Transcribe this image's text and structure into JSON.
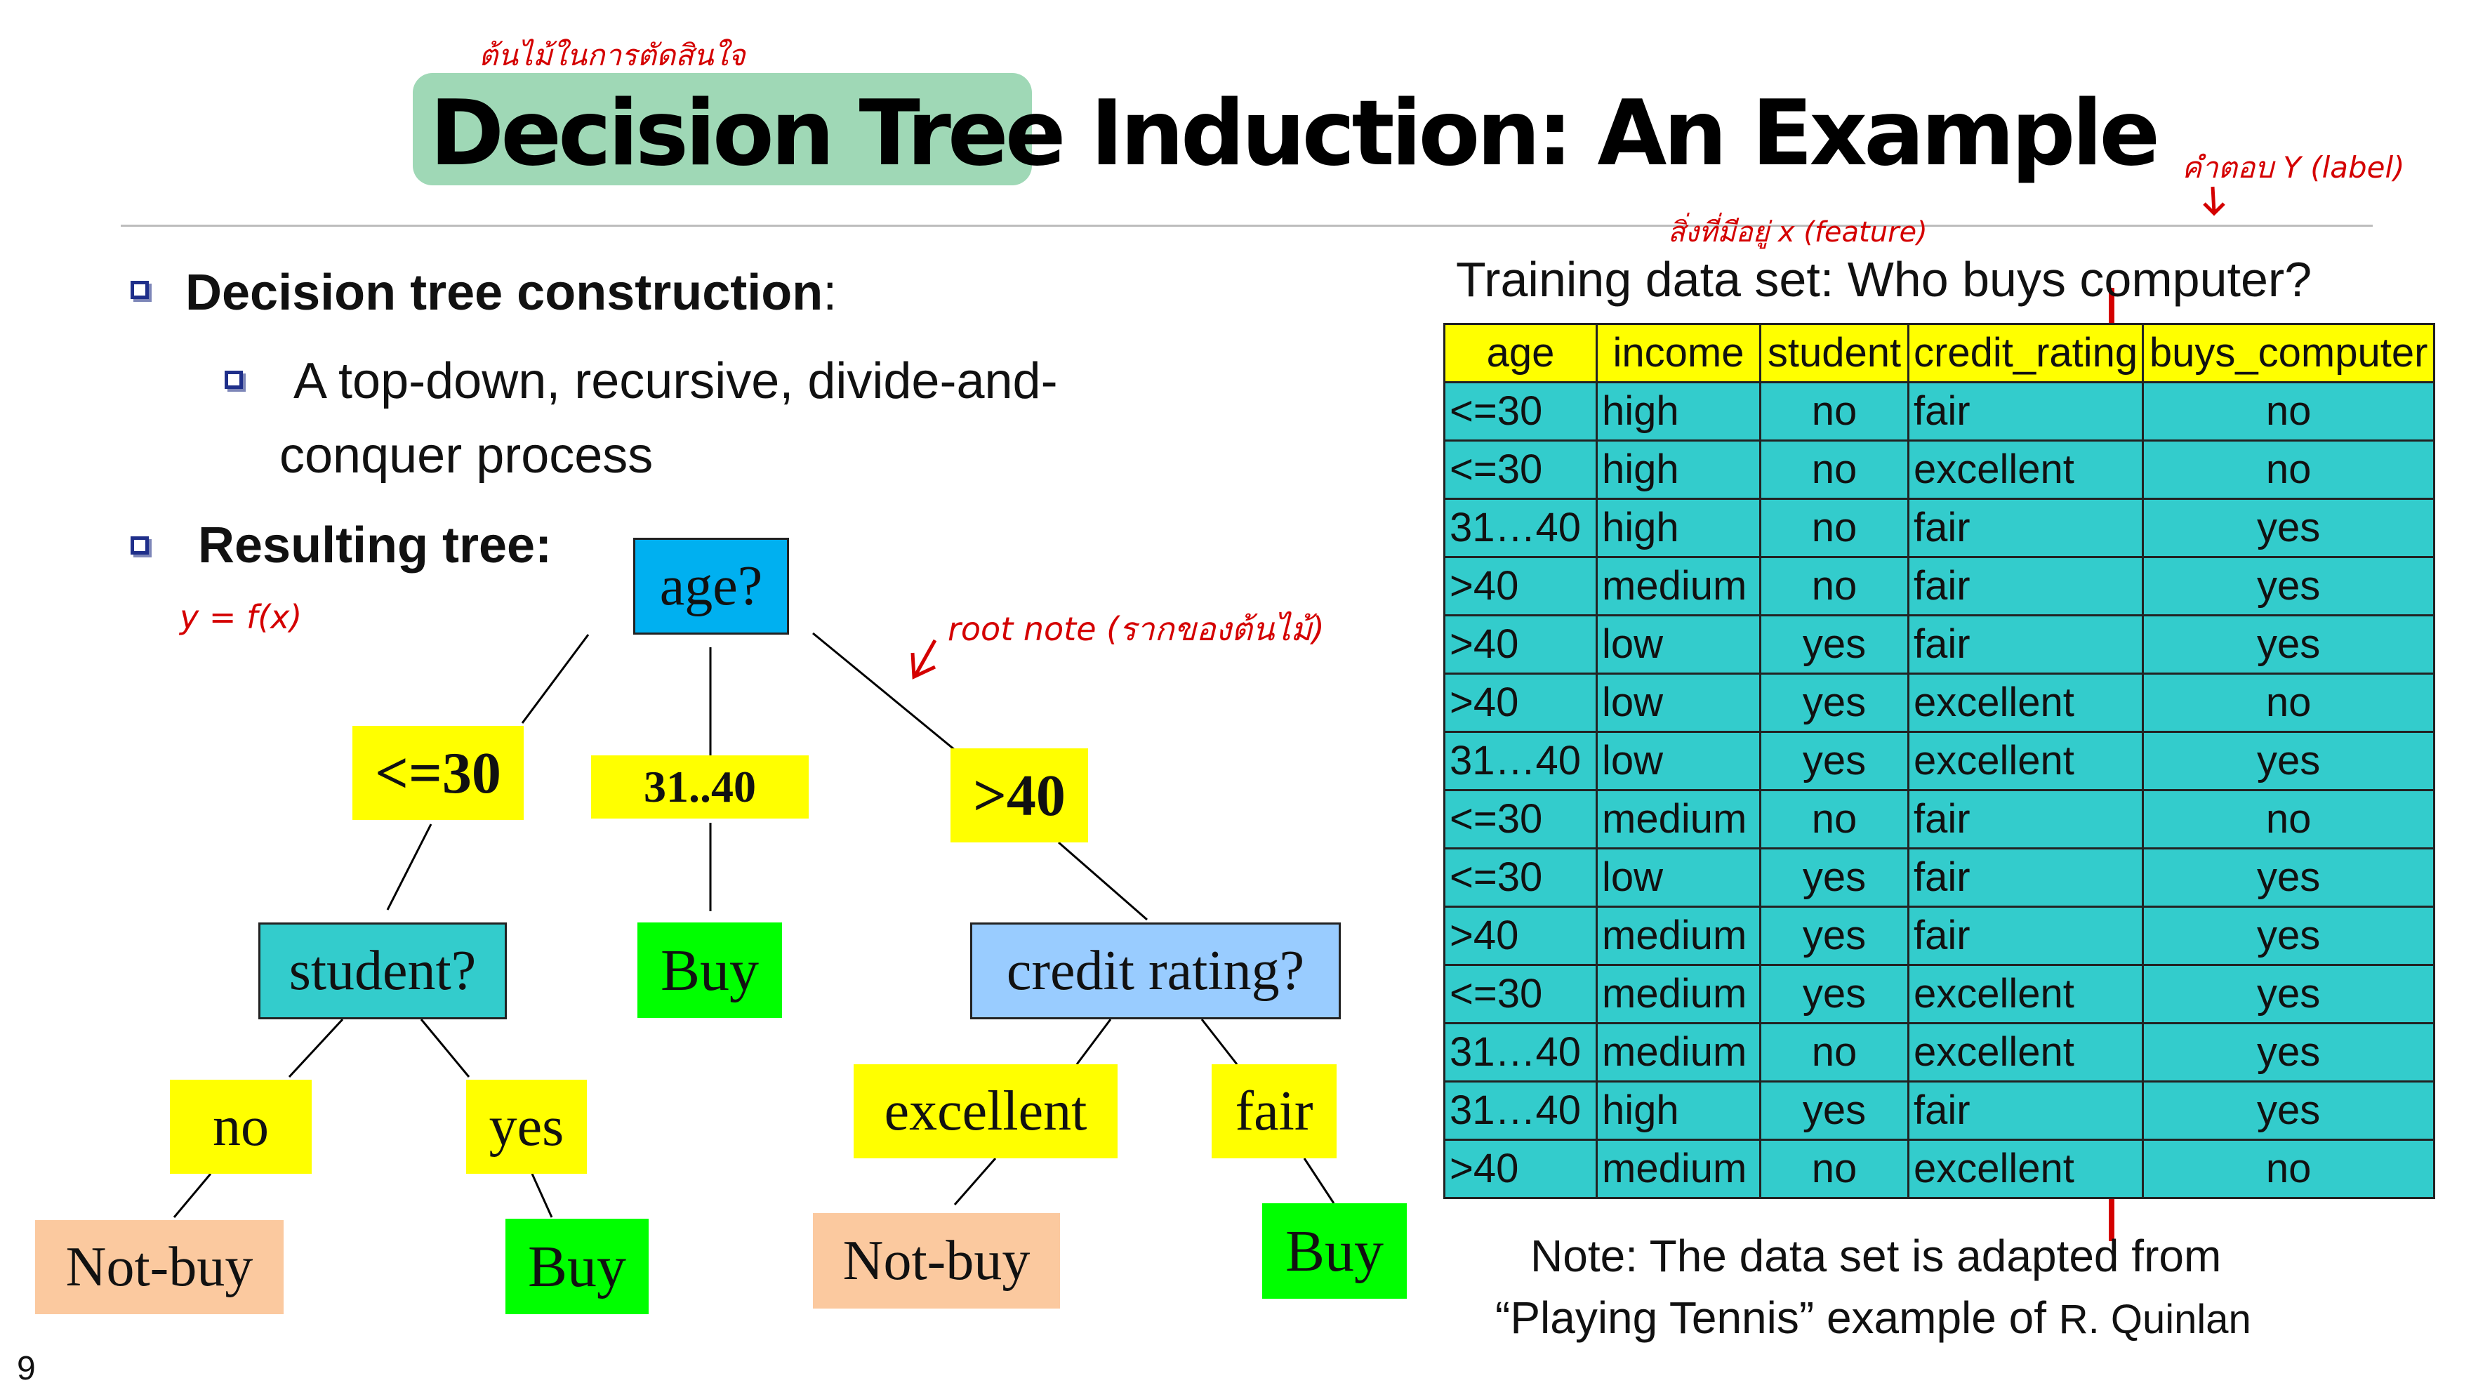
{
  "slide": {
    "title_highlighted": "Decision Tree",
    "title_rest": "Induction: An Example",
    "page_number": "9"
  },
  "annotations": {
    "thai_title": "ต้นไม้ในการตัดสินใจ",
    "y_fx": "y = f(x)",
    "root_note": "root note (รากของต้นไม้)",
    "feature_note": "สิ่งที่มีอยู่ x (feature)",
    "label_note": "คำตอบ Y (label)",
    "colors": {
      "ink": "#d40000"
    }
  },
  "bullets": {
    "b1_bold": "Decision tree construction",
    "b1_colon": ":",
    "b2_line1": "A top-down, recursive, divide-and-",
    "b2_line2": "conquer process",
    "b3": "Resulting tree:"
  },
  "tree": {
    "root": "age?",
    "branch_le30": "<=30",
    "branch_3140": "31..40",
    "branch_gt40": ">40",
    "student": "student?",
    "buy_mid": "Buy",
    "credit": "credit rating?",
    "no": "no",
    "yes": "yes",
    "excellent": "excellent",
    "fair": "fair",
    "notbuy_left": "Not-buy",
    "buy_left": "Buy",
    "notbuy_right": "Not-buy",
    "buy_right": "Buy",
    "colors": {
      "root": "#00b0f0",
      "branch": "#ffff00",
      "student": "#33cccc",
      "buy": "#00ff00",
      "credit": "#99ccff",
      "notbuy": "#fbc99f"
    }
  },
  "training": {
    "caption": "Training data set: Who buys computer?",
    "headers": [
      "age",
      "income",
      "student",
      "credit_rating",
      "buys_computer"
    ],
    "rows": [
      [
        "<=30",
        "high",
        "no",
        "fair",
        "no"
      ],
      [
        "<=30",
        "high",
        "no",
        "excellent",
        "no"
      ],
      [
        "31…40",
        "high",
        "no",
        "fair",
        "yes"
      ],
      [
        ">40",
        "medium",
        "no",
        "fair",
        "yes"
      ],
      [
        ">40",
        "low",
        "yes",
        "fair",
        "yes"
      ],
      [
        ">40",
        "low",
        "yes",
        "excellent",
        "no"
      ],
      [
        "31…40",
        "low",
        "yes",
        "excellent",
        "yes"
      ],
      [
        "<=30",
        "medium",
        "no",
        "fair",
        "no"
      ],
      [
        "<=30",
        "low",
        "yes",
        "fair",
        "yes"
      ],
      [
        ">40",
        "medium",
        "yes",
        "fair",
        "yes"
      ],
      [
        "<=30",
        "medium",
        "yes",
        "excellent",
        "yes"
      ],
      [
        "31…40",
        "medium",
        "no",
        "excellent",
        "yes"
      ],
      [
        "31…40",
        "high",
        "yes",
        "fair",
        "yes"
      ],
      [
        ">40",
        "medium",
        "no",
        "excellent",
        "no"
      ]
    ],
    "colors": {
      "header": "#ffff00",
      "cell": "#33cccc"
    }
  },
  "note": {
    "line1": "Note: The data set is adapted from",
    "line2_main": "“Playing Tennis” example of",
    "line2_small": "R. Quinlan"
  }
}
